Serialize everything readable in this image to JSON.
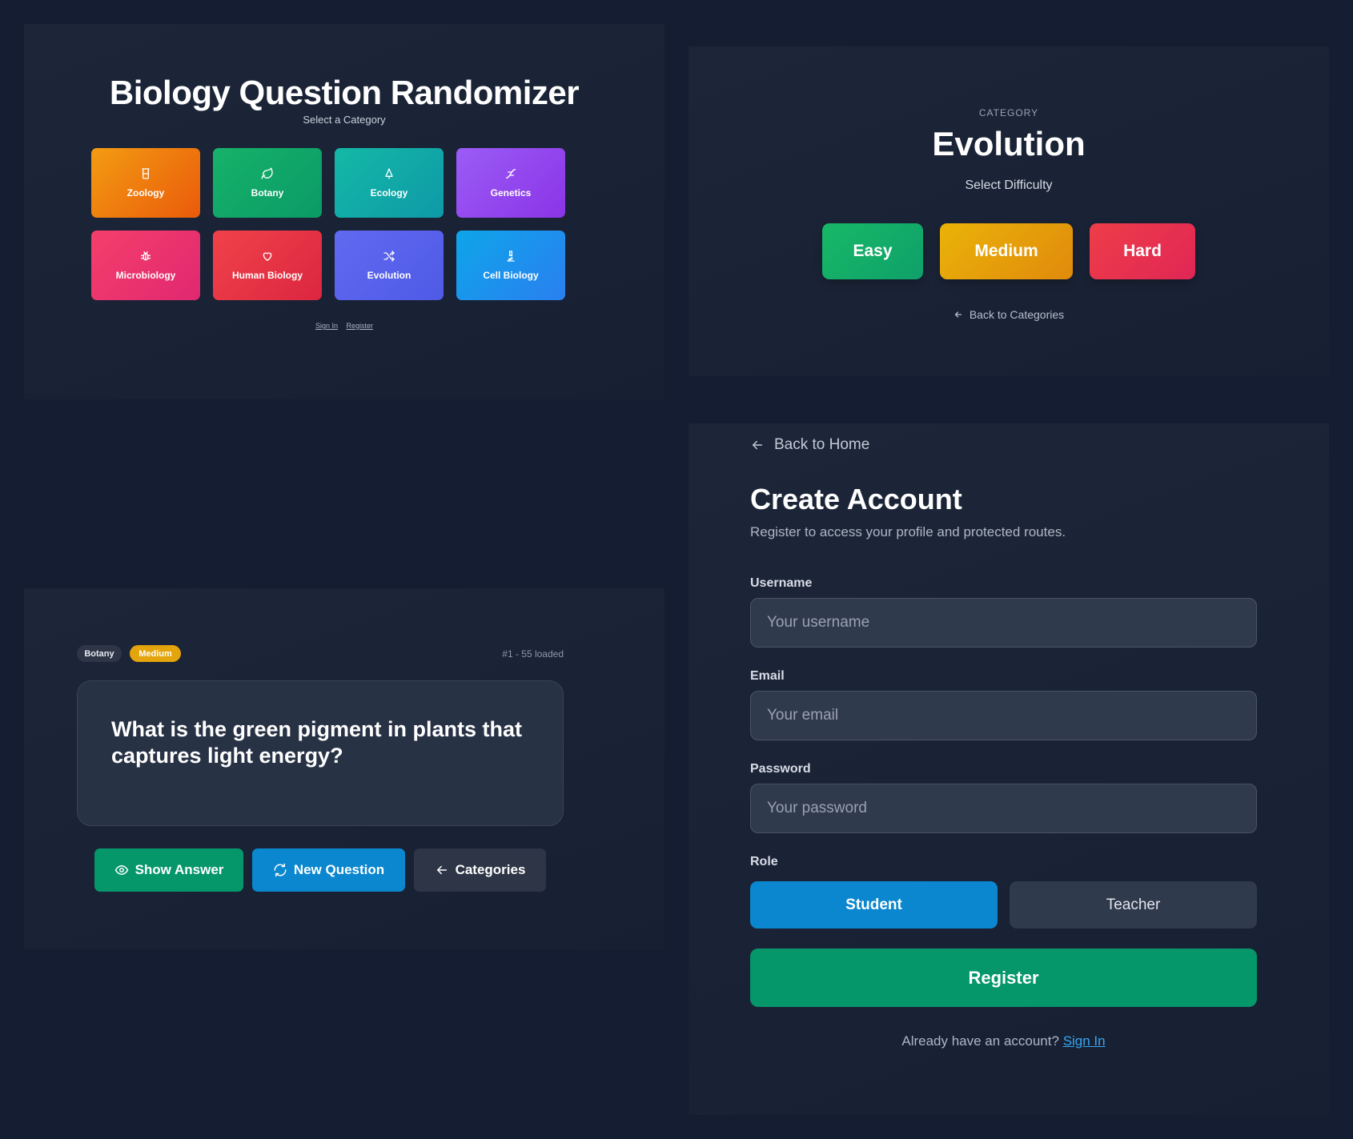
{
  "home": {
    "title": "Biology Question Randomizer",
    "subtitle": "Select a Category",
    "categories": [
      {
        "label": "Zoology",
        "icon": "beaker-icon"
      },
      {
        "label": "Botany",
        "icon": "leaf-icon"
      },
      {
        "label": "Ecology",
        "icon": "tree-icon"
      },
      {
        "label": "Genetics",
        "icon": "dna-icon"
      },
      {
        "label": "Microbiology",
        "icon": "bug-icon"
      },
      {
        "label": "Human Biology",
        "icon": "heart-icon"
      },
      {
        "label": "Evolution",
        "icon": "shuffle-icon"
      },
      {
        "label": "Cell Biology",
        "icon": "microscope-icon"
      }
    ],
    "links": {
      "sign_in": "Sign In",
      "register": "Register"
    }
  },
  "difficulty": {
    "eyebrow": "CATEGORY",
    "category": "Evolution",
    "subtitle": "Select Difficulty",
    "levels": [
      "Easy",
      "Medium",
      "Hard"
    ],
    "back": "Back to Categories"
  },
  "question": {
    "category_badge": "Botany",
    "difficulty_badge": "Medium",
    "meta": "#1 - 55 loaded",
    "text": "What is the green pigment in plants that captures light energy?",
    "actions": {
      "show_answer": "Show Answer",
      "new_question": "New Question",
      "categories": "Categories"
    }
  },
  "register": {
    "back": "Back to Home",
    "title": "Create Account",
    "subtitle": "Register to access your profile and protected routes.",
    "fields": {
      "username": {
        "label": "Username",
        "placeholder": "Your username"
      },
      "email": {
        "label": "Email",
        "placeholder": "Your email"
      },
      "password": {
        "label": "Password",
        "placeholder": "Your password"
      }
    },
    "role": {
      "label": "Role",
      "options": [
        "Student",
        "Teacher"
      ],
      "selected": "Student"
    },
    "submit": "Register",
    "footer_text": "Already have an account?",
    "footer_link": "Sign In"
  },
  "colors": {
    "background": "#141d31",
    "easy": "#12b064",
    "medium": "#e6a20a",
    "hard": "#e83150",
    "register": "#05976a",
    "student": "#0a87cf",
    "link": "#38a6f0"
  }
}
